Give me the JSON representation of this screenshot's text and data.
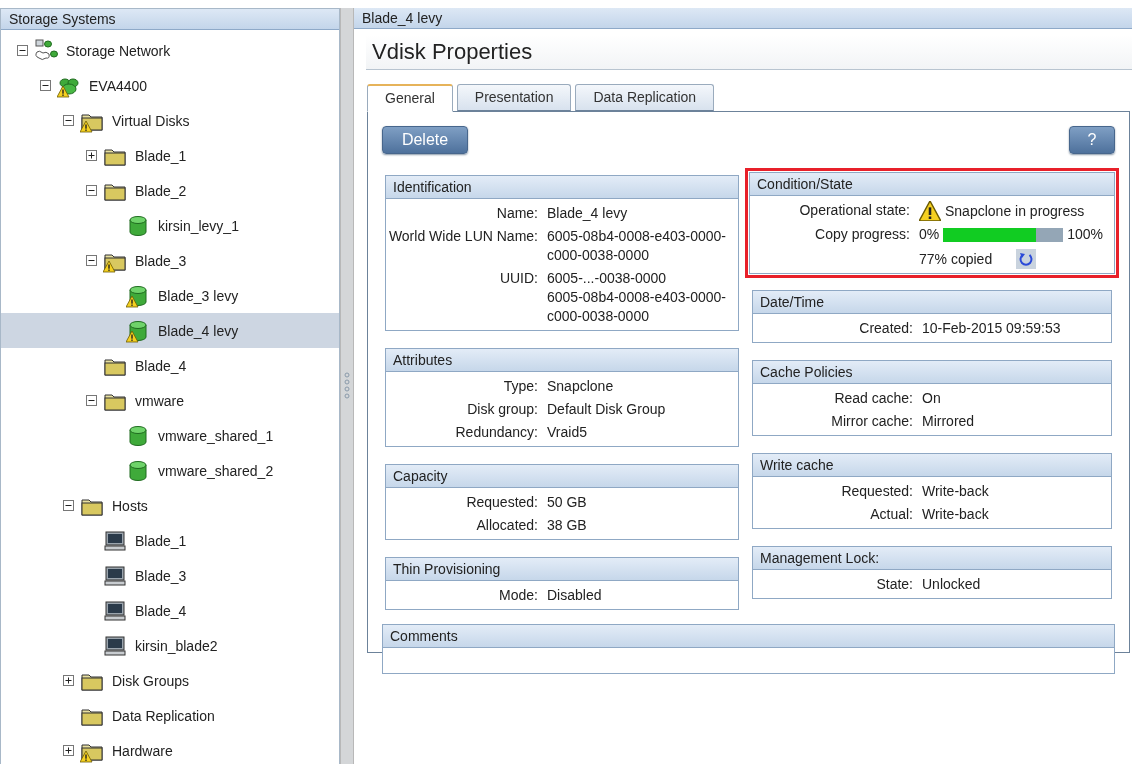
{
  "left_panel": {
    "title": "Storage Systems",
    "tree": [
      {
        "label": "Storage Network",
        "kind": "network",
        "warning": false,
        "expanded": true,
        "selected": false,
        "children": [
          {
            "label": "EVA4400",
            "kind": "array",
            "warning": true,
            "expanded": true,
            "selected": false,
            "children": [
              {
                "label": "Virtual Disks",
                "kind": "folder",
                "warning": true,
                "expanded": true,
                "selected": false,
                "children": [
                  {
                    "label": "Blade_1",
                    "kind": "folder",
                    "warning": false,
                    "expanded": false,
                    "selected": false
                  },
                  {
                    "label": "Blade_2",
                    "kind": "folder",
                    "warning": false,
                    "expanded": true,
                    "selected": false,
                    "children": [
                      {
                        "label": "kirsin_levy_1",
                        "kind": "disk",
                        "warning": false,
                        "selected": false
                      }
                    ]
                  },
                  {
                    "label": "Blade_3",
                    "kind": "folder",
                    "warning": true,
                    "expanded": true,
                    "selected": false,
                    "children": [
                      {
                        "label": "Blade_3 levy",
                        "kind": "disk",
                        "warning": true,
                        "selected": false
                      },
                      {
                        "label": "Blade_4 levy",
                        "kind": "disk",
                        "warning": true,
                        "selected": true
                      }
                    ]
                  },
                  {
                    "label": "Blade_4",
                    "kind": "folder",
                    "warning": false,
                    "selected": false
                  },
                  {
                    "label": "vmware",
                    "kind": "folder",
                    "warning": false,
                    "expanded": true,
                    "selected": false,
                    "children": [
                      {
                        "label": "vmware_shared_1",
                        "kind": "disk",
                        "warning": false,
                        "selected": false
                      },
                      {
                        "label": "vmware_shared_2",
                        "kind": "disk",
                        "warning": false,
                        "selected": false
                      }
                    ]
                  }
                ]
              },
              {
                "label": "Hosts",
                "kind": "folder",
                "warning": false,
                "expanded": true,
                "selected": false,
                "children": [
                  {
                    "label": "Blade_1",
                    "kind": "host",
                    "warning": false,
                    "selected": false
                  },
                  {
                    "label": "Blade_3",
                    "kind": "host",
                    "warning": false,
                    "selected": false
                  },
                  {
                    "label": "Blade_4",
                    "kind": "host",
                    "warning": false,
                    "selected": false
                  },
                  {
                    "label": "kirsin_blade2",
                    "kind": "host",
                    "warning": false,
                    "selected": false
                  }
                ]
              },
              {
                "label": "Disk Groups",
                "kind": "folder",
                "warning": false,
                "expanded": false,
                "selected": false
              },
              {
                "label": "Data Replication",
                "kind": "folder",
                "warning": false,
                "selected": false
              },
              {
                "label": "Hardware",
                "kind": "folder",
                "warning": true,
                "expanded": false,
                "selected": false
              }
            ]
          }
        ]
      }
    ]
  },
  "right_panel": {
    "title": "Blade_4 levy",
    "heading": "Vdisk Properties",
    "tabs": [
      {
        "label": "General",
        "selected": true
      },
      {
        "label": "Presentation",
        "selected": false
      },
      {
        "label": "Data Replication",
        "selected": false
      }
    ],
    "delete_button": "Delete",
    "help_button": "?",
    "left_sections": [
      {
        "title": "Identification",
        "highlighted": false,
        "rows": [
          {
            "kind": "text",
            "label": "Name:",
            "value": [
              "Blade_4 levy"
            ]
          },
          {
            "kind": "text",
            "label": "World Wide LUN Name:",
            "value": [
              "6005-08b4-0008-e403-0000-",
              "c000-0038-0000"
            ]
          },
          {
            "kind": "text",
            "label": "UUID:",
            "value": [
              "6005-...-0038-0000",
              "6005-08b4-0008-e403-0000-",
              "c000-0038-0000"
            ]
          }
        ]
      },
      {
        "title": "Attributes",
        "highlighted": false,
        "rows": [
          {
            "kind": "text",
            "label": "Type:",
            "value": [
              "Snapclone"
            ]
          },
          {
            "kind": "text",
            "label": "Disk group:",
            "value": [
              "Default Disk Group"
            ]
          },
          {
            "kind": "text",
            "label": "Redundancy:",
            "value": [
              "Vraid5"
            ]
          }
        ]
      },
      {
        "title": "Capacity",
        "highlighted": false,
        "rows": [
          {
            "kind": "text",
            "label": "Requested:",
            "value": [
              "50 GB"
            ]
          },
          {
            "kind": "text",
            "label": "Allocated:",
            "value": [
              "38 GB"
            ]
          }
        ]
      },
      {
        "title": "Thin Provisioning",
        "highlighted": false,
        "rows": [
          {
            "kind": "text",
            "label": "Mode:",
            "value": [
              "Disabled"
            ]
          }
        ]
      }
    ],
    "right_sections": [
      {
        "title": "Condition/State",
        "highlighted": true,
        "rows": [
          {
            "kind": "warning",
            "label": "Operational state:",
            "value": [
              "Snapclone in progress"
            ]
          },
          {
            "kind": "progress",
            "label": "Copy progress:",
            "min_label": "0%",
            "max_label": "100%",
            "level": 0.77,
            "caption": "77% copied"
          }
        ]
      },
      {
        "title": "Date/Time",
        "highlighted": false,
        "rows": [
          {
            "kind": "text",
            "label": "Created:",
            "value": [
              "10-Feb-2015 09:59:53"
            ]
          }
        ]
      },
      {
        "title": "Cache Policies",
        "highlighted": false,
        "rows": [
          {
            "kind": "text",
            "label": "Read cache:",
            "value": [
              "On"
            ]
          },
          {
            "kind": "text",
            "label": "Mirror cache:",
            "value": [
              "Mirrored"
            ]
          }
        ]
      },
      {
        "title": "Write cache",
        "highlighted": false,
        "rows": [
          {
            "kind": "text",
            "label": "Requested:",
            "value": [
              "Write-back"
            ]
          },
          {
            "kind": "text",
            "label": "Actual:",
            "value": [
              "Write-back"
            ]
          }
        ]
      },
      {
        "title": "Management Lock:",
        "highlighted": false,
        "rows": [
          {
            "kind": "text",
            "label": "State:",
            "value": [
              "Unlocked"
            ]
          }
        ]
      }
    ],
    "comments": {
      "title": "Comments"
    }
  }
}
